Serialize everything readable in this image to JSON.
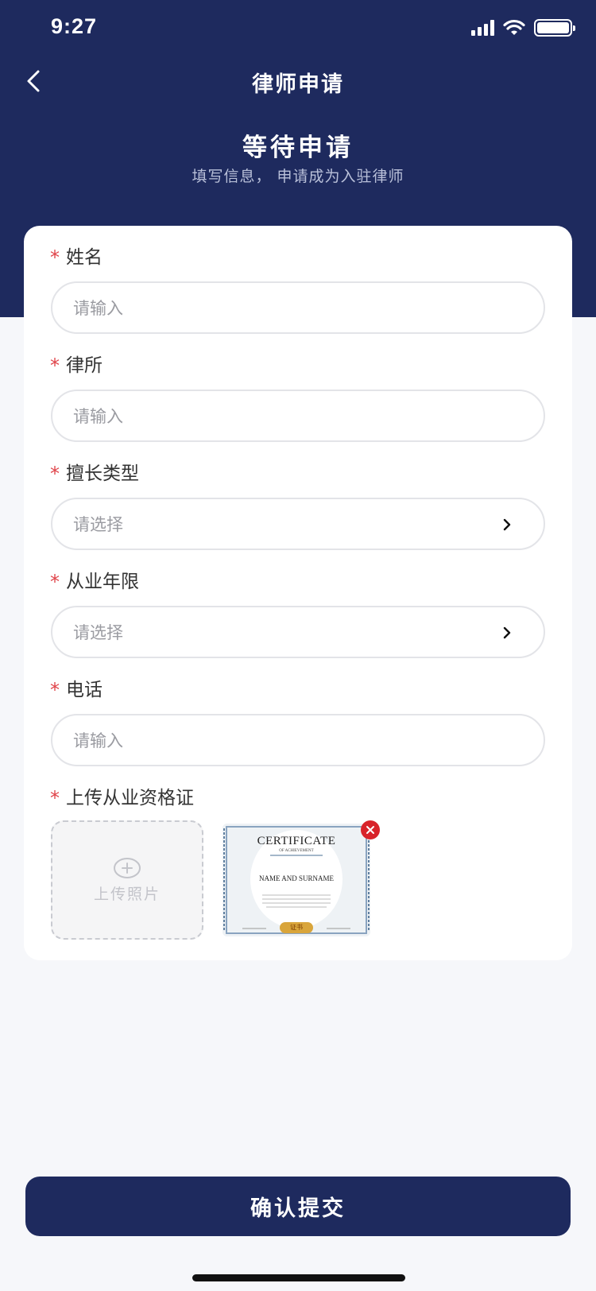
{
  "status_bar": {
    "time": "9:27"
  },
  "nav": {
    "title": "律师申请",
    "back_icon": "chevron-left-icon"
  },
  "hero": {
    "title": "等待申请",
    "subtitle": "填写信息， 申请成为入驻律师"
  },
  "form": {
    "required_mark": "*",
    "fields": [
      {
        "label": "姓名",
        "placeholder": "请输入",
        "kind": "input"
      },
      {
        "label": "律所",
        "placeholder": "请输入",
        "kind": "input"
      },
      {
        "label": "擅长类型",
        "placeholder": "请选择",
        "kind": "select"
      },
      {
        "label": "从业年限",
        "placeholder": "请选择",
        "kind": "select"
      },
      {
        "label": "电话",
        "placeholder": "请输入",
        "kind": "input"
      }
    ],
    "upload": {
      "label": "上传从业资格证",
      "button_text": "上传照片",
      "certificate": {
        "title": "CERTIFICATE",
        "subtitle": "OF ACHIEVEMENT",
        "name": "NAME AND SURNAME",
        "seal": "证书"
      }
    }
  },
  "submit": {
    "label": "确认提交"
  },
  "colors": {
    "brand": "#1e2a5e",
    "required": "#e0444a",
    "delete": "#d8232a"
  }
}
